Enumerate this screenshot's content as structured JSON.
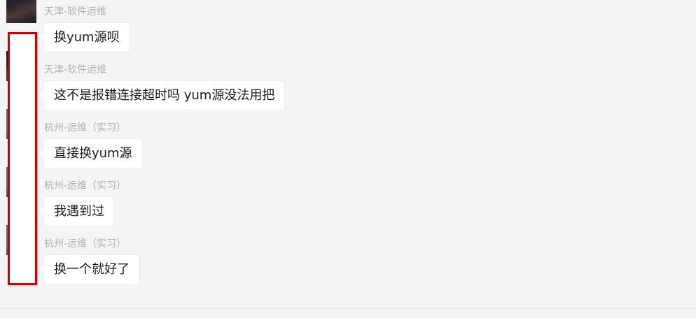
{
  "messages": [
    {
      "sender": "天津-软件运维",
      "text": "换yum源呗",
      "avatar": "avatar-dark"
    },
    {
      "sender": "天津-软件运维",
      "text": "这不是报错连接超时吗  yum源没法用把",
      "avatar": "avatar-dark"
    },
    {
      "sender": "杭州-运维（实习）",
      "text": "直接换yum源",
      "avatar": "avatar-warm"
    },
    {
      "sender": "杭州-运维（实习）",
      "text": "我遇到过",
      "avatar": "avatar-warm"
    },
    {
      "sender": "杭州-运维（实习）",
      "text": "换一个就好了",
      "avatar": "avatar-warm"
    }
  ],
  "colors": {
    "background": "#f5f5f5",
    "bubble": "#ffffff",
    "sender_text": "#b0b0b0",
    "message_text": "#1a1a1a",
    "redaction_border": "#d10000"
  }
}
